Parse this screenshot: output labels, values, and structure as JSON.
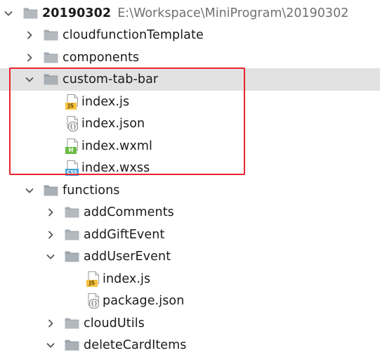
{
  "tree": {
    "root": {
      "name": "20190302",
      "path": "E:\\Workspace\\MiniProgram\\20190302"
    },
    "items": [
      {
        "label": "cloudfunctionTemplate"
      },
      {
        "label": "components"
      },
      {
        "label": "custom-tab-bar"
      },
      {
        "label": "index.js",
        "badge": "JS"
      },
      {
        "label": "index.json",
        "badge": "{}"
      },
      {
        "label": "index.wxml",
        "badge": "H"
      },
      {
        "label": "index.wxss",
        "badge": "CSS"
      },
      {
        "label": "functions"
      },
      {
        "label": "addComments"
      },
      {
        "label": "addGiftEvent"
      },
      {
        "label": "addUserEvent"
      },
      {
        "label": "index.js",
        "badge": "JS"
      },
      {
        "label": "package.json",
        "badge": "{}"
      },
      {
        "label": "cloudUtils"
      },
      {
        "label": "deleteCardItems"
      }
    ]
  },
  "colors": {
    "folder": "#a6acb3",
    "selection": "#e2e2e2",
    "highlight_border": "#e8242b",
    "js_badge": "#f5c242",
    "wxml_badge": "#6cbb46",
    "wxss_badge": "#4aa3d6"
  }
}
